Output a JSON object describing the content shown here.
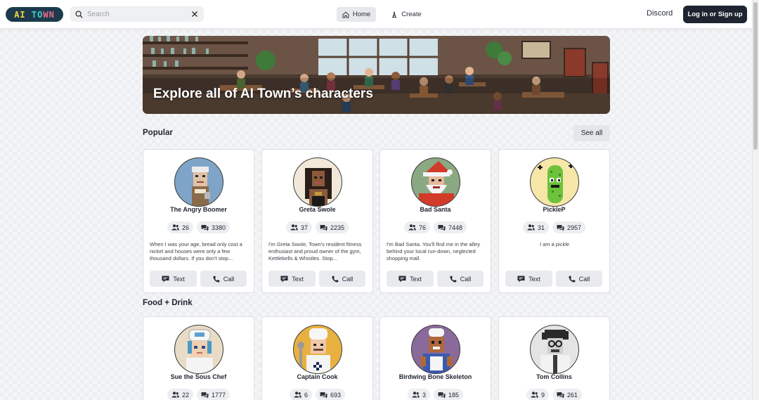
{
  "header": {
    "logo_text": "AI TOWN",
    "search_placeholder": "Search",
    "nav": {
      "home": "Home",
      "create": "Create"
    },
    "discord": "Discord",
    "login": "Log in or Sign up"
  },
  "hero": {
    "title": "Explore all of AI Town’s characters"
  },
  "sections": {
    "popular": {
      "title": "Popular",
      "see_all": "See all"
    },
    "food": {
      "title": "Food + Drink"
    }
  },
  "buttons": {
    "text": "Text",
    "call": "Call"
  },
  "popular_cards": [
    {
      "name": "The Angry Boomer",
      "users": "26",
      "messages": "3380",
      "description": "When I was your age, bread only cost a nickel and houses were only a few thousand dollars. If you don't stop..."
    },
    {
      "name": "Greta Swole",
      "users": "37",
      "messages": "2235",
      "description": "I'm Greta Swole, Town's resident fitness enthusiast and proud owner of the gym, Kettlebells & Whistles. Stop..."
    },
    {
      "name": "Bad Santa",
      "users": "76",
      "messages": "7448",
      "description": "I'm Bad Santa. You'll find me in the alley behind your local run-down, neglected shopping mall."
    },
    {
      "name": "PickleP",
      "users": "31",
      "messages": "2957",
      "description": "I am a pickle"
    }
  ],
  "food_cards": [
    {
      "name": "Sue the Sous Chef",
      "users": "22",
      "messages": "1777"
    },
    {
      "name": "Captain Cook",
      "users": "6",
      "messages": "693"
    },
    {
      "name": "Birdwing Bone Skeleton",
      "users": "3",
      "messages": "185"
    },
    {
      "name": "Tom Collins",
      "users": "9",
      "messages": "261"
    }
  ],
  "colors": {
    "primary_dark": "#1e2530",
    "logo_bg": "#1d3a4c",
    "chip_bg": "#eceef1"
  }
}
